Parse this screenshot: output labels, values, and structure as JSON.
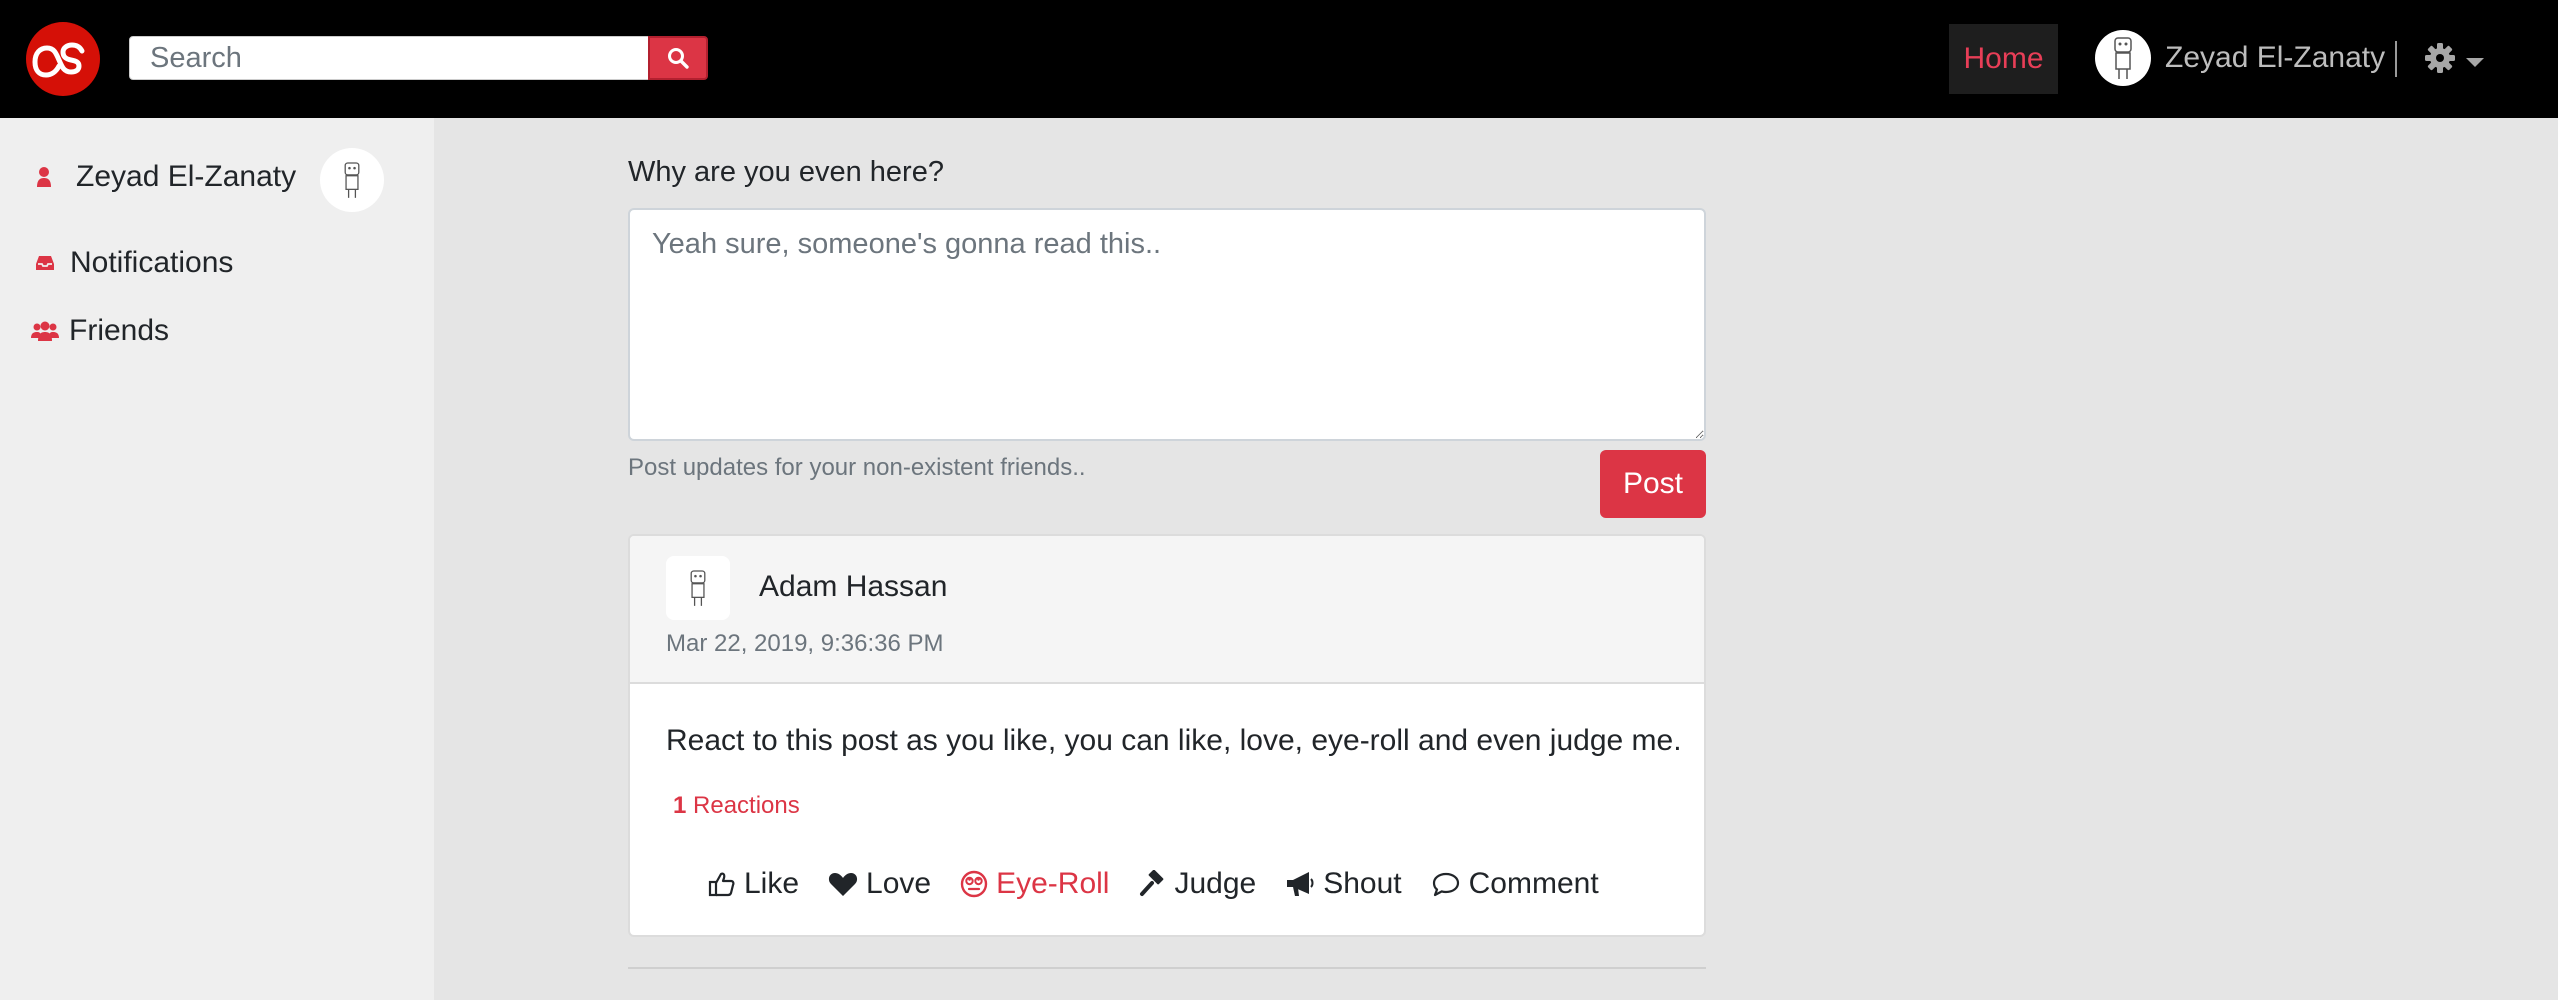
{
  "colors": {
    "accent": "#dc3545",
    "brand": "#d51007",
    "navbar": "#000000"
  },
  "navbar": {
    "logo_icon": "lastfm-logo",
    "search_placeholder": "Search",
    "search_icon": "search-icon",
    "home_label": "Home",
    "username": "Zeyad El-Zanaty",
    "settings_icon": "gear-icon"
  },
  "sidebar": {
    "profile_name": "Zeyad El-Zanaty",
    "items": [
      {
        "label": "Notifications",
        "icon": "inbox-icon"
      },
      {
        "label": "Friends",
        "icon": "users-icon"
      }
    ]
  },
  "composer": {
    "prompt": "Why are you even here?",
    "placeholder": "Yeah sure, someone's gonna read this..",
    "help_text": "Post updates for your non-existent friends..",
    "post_label": "Post"
  },
  "post": {
    "author": "Adam Hassan",
    "timestamp": "Mar 22, 2019, 9:36:36 PM",
    "body": "React to this post as you like, you can like, love, eye-roll and even judge me.",
    "reactions_count": "1",
    "reactions_label": "Reactions",
    "actions": [
      {
        "label": "Like",
        "icon": "thumbs-up-icon",
        "active": false
      },
      {
        "label": "Love",
        "icon": "heart-icon",
        "active": false
      },
      {
        "label": "Eye-Roll",
        "icon": "eye-roll-icon",
        "active": true
      },
      {
        "label": "Judge",
        "icon": "gavel-icon",
        "active": false
      },
      {
        "label": "Shout",
        "icon": "megaphone-icon",
        "active": false
      },
      {
        "label": "Comment",
        "icon": "comment-icon",
        "active": false
      }
    ]
  }
}
